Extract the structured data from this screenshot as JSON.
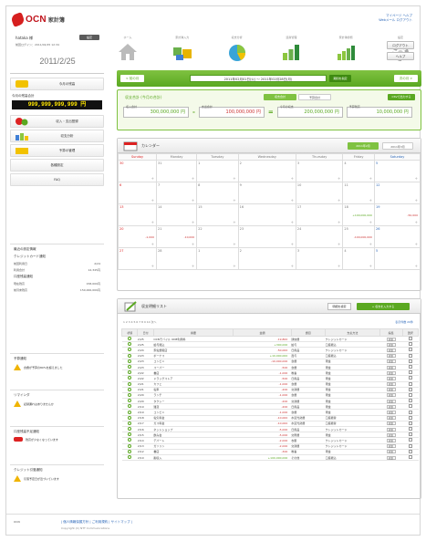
{
  "header": {
    "logo_text": "OCN",
    "logo_sub": "家計簿",
    "links": [
      "マイページ  ヘルプ",
      "Webメール  ログアウト"
    ]
  },
  "user": {
    "name": "hataka 様",
    "mini_button": "設定",
    "sub": "前回ログイン：2011/02/25 12:34",
    "date": "2011/2/25"
  },
  "nav": {
    "items": [
      {
        "label": "ホーム",
        "icon": "home-icon"
      },
      {
        "label": "家計簿入力",
        "icon": "entry-icon"
      },
      {
        "label": "収支分析",
        "icon": "pie-chart-icon"
      },
      {
        "label": "資産管理",
        "icon": "bar-chart-icon"
      },
      {
        "label": "家計簿診断",
        "icon": "growth-chart-icon"
      },
      {
        "label": "設定",
        "icon": "gear-icon"
      }
    ],
    "login_label": "ログアウト",
    "help_label": "ヘルプ"
  },
  "sidebar": {
    "btn_wallet": "今月の残高",
    "balance_caption": "今月の残高合計",
    "balance_amount": "999,999,999,999 円",
    "btn_inout": "収入・支出登録",
    "btn_analysis": "収支分析",
    "btn_budget": "予算の管理",
    "btn_settings": "各種設定",
    "btn_faq": "FAQ",
    "info_title": "最近の設定情報",
    "info1_title": "クレジットカード通知",
    "info1_a": "前回利用日",
    "info1_av": "2/24",
    "info1_b": "利用合計",
    "info1_bv": "12,345円",
    "info2_title": "口座残高通知",
    "info2_a": "現在残高",
    "info2_av": "158,000円",
    "info2_b": "前月末残高",
    "info2_bv": "150,000,000円",
    "warn1_title": "予算通知",
    "warn1_text": "食費が予算の80%を超えました",
    "warn2_title": "リマインダ",
    "warn2_text": "記録漏れはありませんか",
    "warn3_title": "口座残高不足通知",
    "warn3_text": "残高が少なくなっています",
    "warn4_title": "クレジット引落通知",
    "warn4_text": "引落予定日が近づいています"
  },
  "period": {
    "prev": "< 前の月",
    "next": "次の月 >",
    "range": "2011年02月01日(火) ～ 2011年02月28日(月)",
    "go": "期間を指定"
  },
  "totals": {
    "title": "収支合計",
    "subtitle": "(今月の合計)",
    "tab_on": "収支合計",
    "tab_off": "予算合計",
    "export": "CSVで出力する",
    "income_label": "収入合計",
    "income": "300,000,000 円",
    "expense_label": "支出合計",
    "expense": "100,000,000 円",
    "balance_label": "今月の収支",
    "balance": "200,000,000 円",
    "budget_label": "予算残高",
    "budget": "10,000,000 円",
    "op_minus": "-",
    "op_eq": "="
  },
  "calendar": {
    "title": "カレンダー",
    "tab_month": "2011年2月",
    "tab_next": "2011年3月",
    "days": [
      "Sunday",
      "Monday",
      "Tuesday",
      "Wednesday",
      "Thursday",
      "Friday",
      "Saturday"
    ],
    "weeks": [
      [
        [
          "30",
          ""
        ],
        [
          "31",
          ""
        ],
        [
          "1",
          ""
        ],
        [
          "2",
          ""
        ],
        [
          "3",
          ""
        ],
        [
          "4",
          ""
        ],
        [
          "5",
          ""
        ]
      ],
      [
        [
          "6",
          ""
        ],
        [
          "7",
          ""
        ],
        [
          "8",
          ""
        ],
        [
          "9",
          ""
        ],
        [
          "10",
          ""
        ],
        [
          "11",
          ""
        ],
        [
          "12",
          ""
        ]
      ],
      [
        [
          "13",
          ""
        ],
        [
          "14",
          ""
        ],
        [
          "15",
          ""
        ],
        [
          "16",
          ""
        ],
        [
          "17",
          ""
        ],
        [
          "18",
          "+100,000,000"
        ],
        [
          "19",
          "-50,000"
        ]
      ],
      [
        [
          "20",
          "-1,000"
        ],
        [
          "21",
          "-10,000"
        ],
        [
          "22",
          ""
        ],
        [
          "23",
          ""
        ],
        [
          "24",
          ""
        ],
        [
          "25",
          "-100,000,000"
        ],
        [
          "26",
          ""
        ]
      ],
      [
        [
          "27",
          ""
        ],
        [
          "28",
          ""
        ],
        [
          "1",
          ""
        ],
        [
          "2",
          ""
        ],
        [
          "3",
          ""
        ],
        [
          "4",
          ""
        ],
        [
          "5",
          ""
        ]
      ]
    ]
  },
  "list": {
    "title": "収支明細リスト",
    "btn_search": "明細を検索",
    "btn_add": "+ 収支を入力する",
    "pager": "1 2 3 4 5 6 7 8 9 10 次へ",
    "pager_right": "表示件数 20件",
    "columns": [
      "状態",
      "日付",
      "摘要",
      "金額",
      "費目",
      "支払方法",
      "編集",
      "選択"
    ],
    "rows": [
      [
        "2/25",
        "OCNモバイル ONE利用料",
        "-19,800",
        "通信費",
        "クレジットカード"
      ],
      [
        "2/25",
        "給与振込",
        "+300,000",
        "給与",
        "口座振込"
      ],
      [
        "2/24",
        "家電量販店",
        "-50,000",
        "日用品",
        "クレジットカード"
      ],
      [
        "2/23",
        "ボーナス",
        "+10,000,000",
        "賞与",
        "口座振込"
      ],
      [
        "2/23",
        "コンビニ",
        "-10,000,000",
        "食費",
        "現金"
      ],
      [
        "2/23",
        "スーパー",
        "-500",
        "食費",
        "現金"
      ],
      [
        "2/22",
        "書店",
        "-1,000",
        "教養",
        "現金"
      ],
      [
        "2/22",
        "ドラッグストア",
        "-500",
        "日用品",
        "現金"
      ],
      [
        "2/21",
        "カフェ",
        "-1,000",
        "食費",
        "現金"
      ],
      [
        "2/21",
        "電車",
        "-200",
        "交通費",
        "現金"
      ],
      [
        "2/20",
        "ランチ",
        "-1,000",
        "食費",
        "現金"
      ],
      [
        "2/20",
        "タクシー",
        "-200",
        "交通費",
        "現金"
      ],
      [
        "2/19",
        "雑貨",
        "-200",
        "日用品",
        "現金"
      ],
      [
        "2/19",
        "コンビニ",
        "-1,000",
        "食費",
        "現金"
      ],
      [
        "2/18",
        "電気料金",
        "-10,000",
        "水道光熱費",
        "口座振替"
      ],
      [
        "2/17",
        "ガス料金",
        "-10,000",
        "水道光熱費",
        "口座振替"
      ],
      [
        "2/16",
        "ネットショップ",
        "-5,000",
        "日用品",
        "クレジットカード"
      ],
      [
        "2/15",
        "飲み会",
        "-5,000",
        "交際費",
        "現金"
      ],
      [
        "2/14",
        "デパート",
        "-2,000",
        "衣服",
        "クレジットカード"
      ],
      [
        "2/13",
        "ガソリン",
        "-2,000",
        "交通費",
        "クレジットカード"
      ],
      [
        "2/12",
        "書店",
        "-300",
        "教養",
        "現金"
      ],
      [
        "2/10",
        "副収入",
        "+100,000,000",
        "その他",
        "口座振込"
      ]
    ],
    "edit_label": "修正"
  },
  "footer": {
    "logo": "OCN",
    "links": "| 個人情報保護方針 | ご利用規約 | サイトマップ |",
    "copyright": "Copyright (C) NTT Communications"
  }
}
